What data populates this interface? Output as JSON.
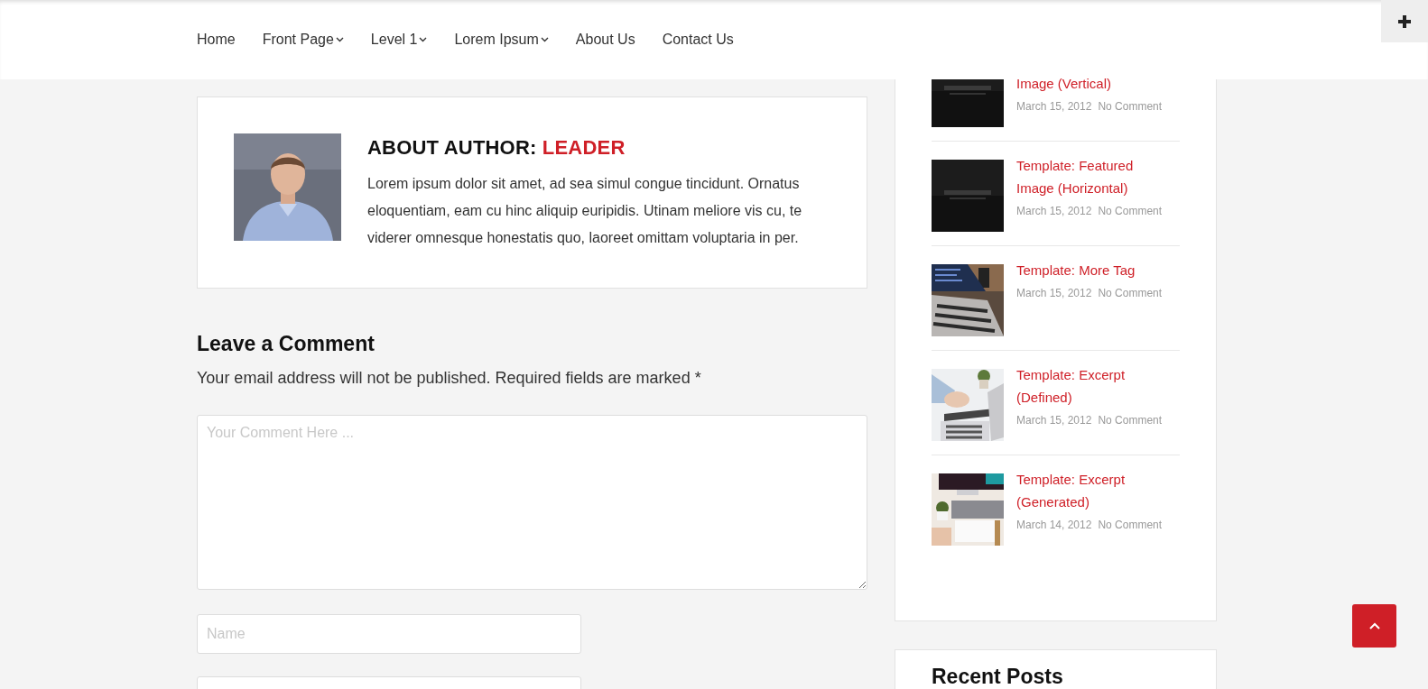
{
  "header": {
    "menu": [
      {
        "label": "Home",
        "has_submenu": false
      },
      {
        "label": "Front Page",
        "has_submenu": true
      },
      {
        "label": "Level 1",
        "has_submenu": true
      },
      {
        "label": "Lorem Ipsum",
        "has_submenu": true
      },
      {
        "label": "About Us",
        "has_submenu": false
      },
      {
        "label": "Contact Us",
        "has_submenu": false
      }
    ]
  },
  "author_box": {
    "heading": "ABOUT AUTHOR:",
    "name": "LEADER",
    "bio": "Lorem ipsum dolor sit amet, ad sea simul congue tincidunt. Ornatus eloquentiam, eam cu hinc aliquip euripidis. Utinam meliore vis cu, te viderer omnesque honestatis quo, laoreet omittam voluptaria in per."
  },
  "comment_form": {
    "title": "Leave a Comment",
    "note": "Your email address will not be published. Required fields are marked *",
    "fields": [
      {
        "kind": "textarea",
        "placeholder": "Your Comment Here ..."
      },
      {
        "kind": "input",
        "placeholder": "Name"
      },
      {
        "kind": "input"
      }
    ]
  },
  "sidebar": {
    "posts": [
      {
        "title": "Image (Vertical)",
        "date": "March 15, 2012",
        "comments": "No Comment",
        "cut": true
      },
      {
        "title": "Template: Featured Image (Horizontal)",
        "date": "March 15, 2012",
        "comments": "No Comment",
        "cut": false
      },
      {
        "title": "Template: More Tag",
        "date": "March 15, 2012",
        "comments": "No Comment",
        "cut": false
      },
      {
        "title": "Template: Excerpt (Defined)",
        "date": "March 15, 2012",
        "comments": "No Comment",
        "cut": false
      },
      {
        "title": "Template: Excerpt (Generated)",
        "date": "March 14, 2012",
        "comments": "No Comment",
        "cut": false
      }
    ],
    "next_widget": {
      "title": "Recent Posts"
    }
  }
}
